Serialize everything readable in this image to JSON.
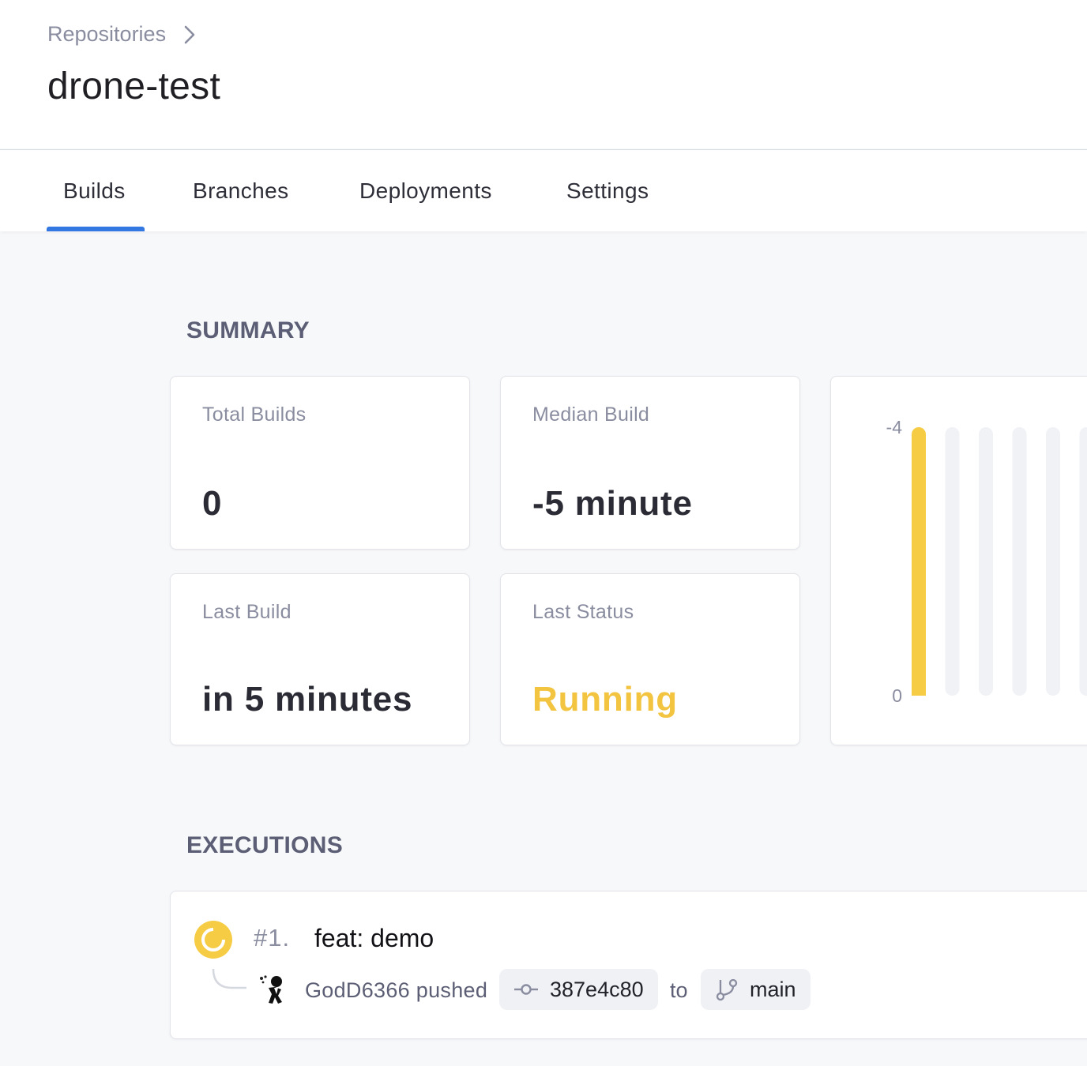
{
  "breadcrumb": {
    "parent": "Repositories"
  },
  "page": {
    "title": "drone-test"
  },
  "tabs": [
    {
      "label": "Builds",
      "active": true
    },
    {
      "label": "Branches",
      "active": false
    },
    {
      "label": "Deployments",
      "active": false
    },
    {
      "label": "Settings",
      "active": false
    }
  ],
  "summary": {
    "heading": "SUMMARY",
    "cards": [
      {
        "label": "Total Builds",
        "value": "0"
      },
      {
        "label": "Median Build",
        "value": "-5 minute"
      },
      {
        "label": "Last Build",
        "value": "in 5 minutes"
      },
      {
        "label": "Last Status",
        "value": "Running"
      }
    ],
    "status_color": "#f2c440"
  },
  "chart_data": {
    "type": "bar",
    "y_tick_labels": [
      "-4",
      "0"
    ],
    "values": [
      -4,
      null,
      null,
      null,
      null,
      null
    ],
    "colors": {
      "bar": "#f6cc45",
      "empty_bar": "#f1f2f6"
    }
  },
  "executions": {
    "heading": "EXECUTIONS",
    "items": [
      {
        "number": "#1.",
        "message": "feat: demo",
        "author": "GodD6366 pushed",
        "commit": "387e4c80",
        "to": "to",
        "branch": "main",
        "status": "running",
        "status_color": "#f6cc45"
      }
    ]
  },
  "colors": {
    "accent": "#3277e2",
    "running": "#f2c440"
  }
}
